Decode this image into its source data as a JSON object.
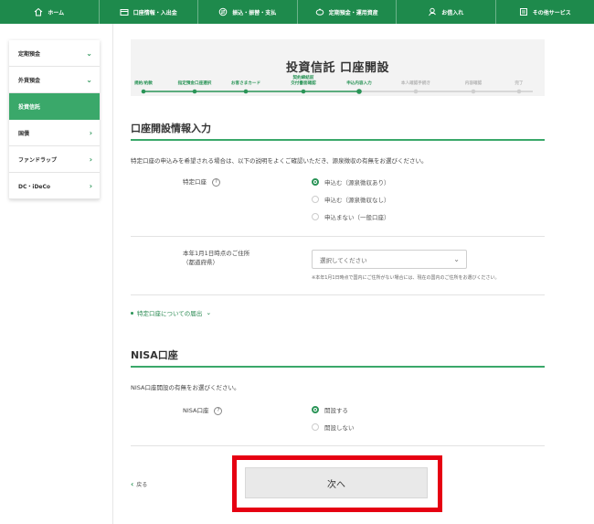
{
  "nav": [
    {
      "label": "ホーム",
      "icon": "home-icon"
    },
    {
      "label": "口座情報・入出金",
      "icon": "wallet-icon"
    },
    {
      "label": "振込・振替・支払",
      "icon": "transfer-icon"
    },
    {
      "label": "定期預金・運用資産",
      "icon": "piggy-bank-icon"
    },
    {
      "label": "お借入れ",
      "icon": "loan-icon"
    },
    {
      "label": "その他サービス",
      "icon": "menu-icon"
    }
  ],
  "sidebar": [
    {
      "label": "定期預金",
      "chev": "⌄",
      "active": false
    },
    {
      "label": "外貨預金",
      "chev": "⌄",
      "active": false
    },
    {
      "label": "投資信託",
      "chev": "",
      "active": true
    },
    {
      "label": "国債",
      "chev": "›",
      "active": false
    },
    {
      "label": "ファンドラップ",
      "chev": "›",
      "active": false
    },
    {
      "label": "DC・iDeCo",
      "chev": "›",
      "active": false
    }
  ],
  "page_title": "投資信託 口座開設",
  "steps": [
    {
      "label": "規約/約款",
      "state": "done"
    },
    {
      "label": "指定預金口座選択",
      "state": "done"
    },
    {
      "label": "お客さまカード",
      "state": "done"
    },
    {
      "label": "契約締結前\n交付書面確認",
      "state": "done"
    },
    {
      "label": "申込内容入力",
      "state": "current"
    },
    {
      "label": "本人確認手続き",
      "state": "todo"
    },
    {
      "label": "内容確認",
      "state": "todo"
    },
    {
      "label": "完了",
      "state": "todo"
    }
  ],
  "account_section": {
    "title": "口座開設情報入力",
    "description": "特定口座の申込みを希望される場合は、以下の説明をよくご確認いただき、源泉徴収の有無をお選びください。",
    "tokutei_label": "特定口座",
    "help": "?",
    "tokutei_options": [
      {
        "label": "申込む（源泉徴収あり）",
        "selected": true
      },
      {
        "label": "申込む（源泉徴収なし）",
        "selected": false
      },
      {
        "label": "申込まない（一般口座）",
        "selected": false
      }
    ],
    "address_label_line1": "本年1月1日時点のご住所",
    "address_label_line2": "（都道府県）",
    "address_placeholder": "選択してください",
    "address_note": "※本年1月1日時点で国内にご住所がない場合には、現在の国内のご住所をお選びください。",
    "notice_link": "特定口座についての届出"
  },
  "nisa_section": {
    "title": "NISA口座",
    "description": "NISA口座開設の有無をお選びください。",
    "label": "NISA口座",
    "help": "?",
    "options": [
      {
        "label": "開設する",
        "selected": true
      },
      {
        "label": "開設しない",
        "selected": false
      }
    ]
  },
  "back_label": "戻る",
  "next_label": "次へ",
  "colors": {
    "brand": "#1e8a4c",
    "accent": "#3aa86a",
    "highlight": "#e60012"
  }
}
